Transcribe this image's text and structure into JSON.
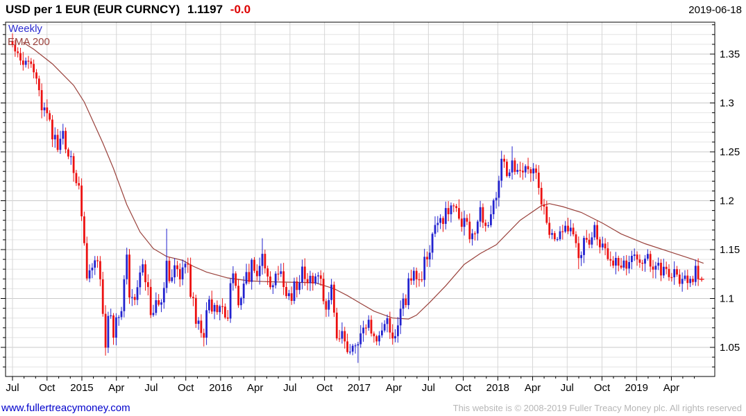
{
  "header": {
    "instrument": "USD per 1 EUR (EUR CURNCY)",
    "last_price": "1.1197",
    "change": "-0.0",
    "date": "2019-06-18"
  },
  "legend": {
    "timeframe": "Weekly",
    "overlay": "EMA 200"
  },
  "footer": {
    "website": "www.fullertreacymoney.com",
    "copyright": "This website is © 2008-2019 Fuller Treacy Money plc. All rights reserved"
  },
  "colors": {
    "up_candle": "#2323cf",
    "down_candle": "#ec1111",
    "ema_line": "#99403a",
    "timeframe_label": "#2b2bd0",
    "overlay_label": "#99403a",
    "change_text": "#dd0000",
    "link": "#0000cc",
    "copyright_text": "#b6b6b6",
    "grid_major": "#c9c9c9",
    "grid_minor": "#e4e4e4",
    "grid_vertical": "#d6d6d6",
    "axis": "#000000"
  },
  "chart_data": {
    "type": "candlestick",
    "title": "USD per 1 EUR (EUR CURNCY)",
    "timeframe": "weekly",
    "overlay": "EMA 200",
    "grid": true,
    "x_start": "2014-07",
    "x_end": "2019-06-18",
    "ylim": [
      1.02,
      1.383
    ],
    "yticks": [
      1.05,
      1.1,
      1.15,
      1.2,
      1.25,
      1.3,
      1.35
    ],
    "ytick_labels": [
      "1.05",
      "1.1",
      "1.15",
      "1.2",
      "1.25",
      "1.3",
      "1.35"
    ],
    "xticks": [
      {
        "label": "Jul",
        "wk": 0
      },
      {
        "label": "Oct",
        "wk": 13.0
      },
      {
        "label": "2015",
        "wk": 26.1
      },
      {
        "label": "Apr",
        "wk": 39.1
      },
      {
        "label": "Jul",
        "wk": 52.2
      },
      {
        "label": "Oct",
        "wk": 65.2
      },
      {
        "label": "2016",
        "wk": 78.3
      },
      {
        "label": "Apr",
        "wk": 91.3
      },
      {
        "label": "Jul",
        "wk": 104.4
      },
      {
        "label": "Oct",
        "wk": 117.4
      },
      {
        "label": "2017",
        "wk": 130.4
      },
      {
        "label": "Apr",
        "wk": 143.5
      },
      {
        "label": "Jul",
        "wk": 156.5
      },
      {
        "label": "Oct",
        "wk": 169.6
      },
      {
        "label": "2018",
        "wk": 182.6
      },
      {
        "label": "Apr",
        "wk": 195.7
      },
      {
        "label": "Jul",
        "wk": 208.7
      },
      {
        "label": "Oct",
        "wk": 221.8
      },
      {
        "label": "2019",
        "wk": 234.8
      },
      {
        "label": "Apr",
        "wk": 247.9
      }
    ],
    "last_price": 1.1197,
    "weekly_close": [
      1.3595,
      1.3527,
      1.351,
      1.3434,
      1.339,
      1.3432,
      1.3425,
      1.3399,
      1.3313,
      1.325,
      1.3131,
      1.2925,
      1.2954,
      1.2895,
      1.283,
      1.2628,
      1.2674,
      1.252,
      1.2634,
      1.2714,
      1.2525,
      1.2453,
      1.2456,
      1.2284,
      1.218,
      1.2155,
      1.184,
      1.1566,
      1.1205,
      1.1288,
      1.1315,
      1.139,
      1.1382,
      1.1196,
      1.0843,
      1.0497,
      1.0821,
      1.0827,
      1.0599,
      1.0807,
      1.0809,
      1.087,
      1.1197,
      1.1449,
      1.101,
      1.1015,
      1.0986,
      1.1115,
      1.1266,
      1.135,
      1.1167,
      1.1118,
      1.0831,
      1.0852,
      1.0982,
      1.0936,
      1.096,
      1.1108,
      1.1386,
      1.1177,
      1.1216,
      1.1339,
      1.13,
      1.1196,
      1.1318,
      1.1355,
      1.1347,
      1.1017,
      1.1005,
      1.0741,
      1.0774,
      1.0647,
      1.0599,
      1.088,
      1.0991,
      1.0866,
      1.0933,
      1.086,
      1.0921,
      1.0917,
      1.0806,
      1.0794,
      1.1156,
      1.1256,
      1.113,
      1.0931,
      1.1004,
      1.1152,
      1.127,
      1.117,
      1.1396,
      1.1283,
      1.1228,
      1.1333,
      1.1457,
      1.1308,
      1.1225,
      1.1116,
      1.1135,
      1.1254,
      1.1252,
      1.1278,
      1.1117,
      1.1024,
      1.1053,
      1.0975,
      1.1175,
      1.1087,
      1.1163,
      1.1326,
      1.1198,
      1.1157,
      1.1232,
      1.1154,
      1.1226,
      1.1236,
      1.1202,
      1.0972,
      1.0886,
      1.0984,
      1.1141,
      1.0855,
      1.0591,
      1.0589,
      1.0667,
      1.0561,
      1.0452,
      1.0456,
      1.0517,
      1.052,
      1.0532,
      1.0643,
      1.0702,
      1.0699,
      1.0782,
      1.0641,
      1.0614,
      1.0561,
      1.0623,
      1.0672,
      1.0739,
      1.0798,
      1.0652,
      1.0592,
      1.0615,
      1.0725,
      1.0895,
      1.0999,
      1.0932,
      1.1206,
      1.1183,
      1.1283,
      1.1196,
      1.1195,
      1.119,
      1.1426,
      1.14,
      1.1469,
      1.1662,
      1.1752,
      1.1773,
      1.1823,
      1.1763,
      1.1925,
      1.1862,
      1.1952,
      1.1945,
      1.1925,
      1.1817,
      1.1733,
      1.1823,
      1.1786,
      1.1607,
      1.1666,
      1.1665,
      1.1787,
      1.1934,
      1.1775,
      1.1742,
      1.1749,
      1.1862,
      1.2005,
      1.203,
      1.2205,
      1.2429,
      1.2399,
      1.2252,
      1.2289,
      1.2412,
      1.2295,
      1.2315,
      1.2307,
      1.229,
      1.2354,
      1.2322,
      1.228,
      1.233,
      1.2287,
      1.2131,
      1.1962,
      1.194,
      1.1774,
      1.1651,
      1.1669,
      1.1606,
      1.1607,
      1.1687,
      1.1684,
      1.1744,
      1.1687,
      1.1724,
      1.1656,
      1.1566,
      1.1413,
      1.1444,
      1.162,
      1.1601,
      1.1551,
      1.1625,
      1.1751,
      1.1604,
      1.1523,
      1.1562,
      1.1513,
      1.1403,
      1.1388,
      1.1336,
      1.1415,
      1.1336,
      1.1316,
      1.1388,
      1.1306,
      1.1372,
      1.1436,
      1.145,
      1.1399,
      1.1365,
      1.1356,
      1.1407,
      1.1455,
      1.1326,
      1.1295,
      1.1335,
      1.1365,
      1.1235,
      1.1324,
      1.1302,
      1.1218,
      1.1216,
      1.13,
      1.1245,
      1.115,
      1.12,
      1.1234,
      1.1158,
      1.1201,
      1.1169,
      1.1334,
      1.1197
    ],
    "extremes": [
      {
        "i": 35,
        "low": 1.0458
      },
      {
        "i": 58,
        "high": 1.1714
      },
      {
        "i": 73,
        "low": 1.0524
      },
      {
        "i": 94,
        "high": 1.1616
      },
      {
        "i": 130,
        "low": 1.0341
      },
      {
        "i": 188,
        "high": 1.2556
      },
      {
        "i": 213,
        "low": 1.1301
      },
      {
        "i": 244,
        "low": 1.1177
      },
      {
        "i": 254,
        "low": 1.1107
      }
    ],
    "ema_200": [
      [
        4,
        1.362
      ],
      [
        8,
        1.355
      ],
      [
        15,
        1.34
      ],
      [
        23,
        1.318
      ],
      [
        27,
        1.301
      ],
      [
        34,
        1.259
      ],
      [
        38,
        1.233
      ],
      [
        43,
        1.196
      ],
      [
        48,
        1.168
      ],
      [
        53,
        1.151
      ],
      [
        58,
        1.143
      ],
      [
        64,
        1.139
      ],
      [
        68,
        1.133
      ],
      [
        73,
        1.127
      ],
      [
        81,
        1.121
      ],
      [
        89,
        1.118
      ],
      [
        98,
        1.117
      ],
      [
        114,
        1.116
      ],
      [
        121,
        1.11
      ],
      [
        126,
        1.103
      ],
      [
        131,
        1.095
      ],
      [
        136,
        1.087
      ],
      [
        143,
        1.08
      ],
      [
        149,
        1.079
      ],
      [
        152,
        1.083
      ],
      [
        157,
        1.096
      ],
      [
        163,
        1.113
      ],
      [
        170,
        1.135
      ],
      [
        176,
        1.146
      ],
      [
        182,
        1.155
      ],
      [
        191,
        1.18
      ],
      [
        199,
        1.195
      ],
      [
        202,
        1.197
      ],
      [
        207,
        1.194
      ],
      [
        214,
        1.188
      ],
      [
        222,
        1.177
      ],
      [
        229,
        1.166
      ],
      [
        238,
        1.156
      ],
      [
        247,
        1.148
      ],
      [
        256,
        1.14
      ],
      [
        260,
        1.136
      ]
    ]
  }
}
